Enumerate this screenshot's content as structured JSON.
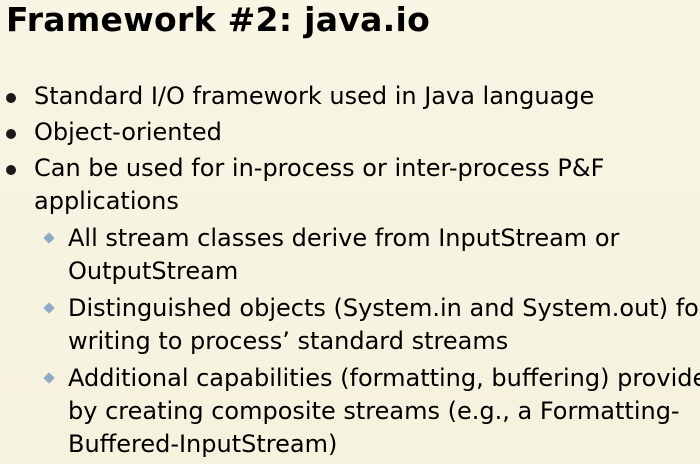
{
  "title": "Framework #2: java.io",
  "bullets": [
    {
      "lines": [
        "Standard I/O framework used in Java language"
      ]
    },
    {
      "lines": [
        "Object-oriented"
      ]
    },
    {
      "lines": [
        "Can be used for in-process or inter-process P&F",
        "applications"
      ],
      "sub_bullets": [
        {
          "lines": [
            "All stream classes derive from InputStream or",
            "OutputStream"
          ]
        },
        {
          "lines": [
            "Distinguished objects (System.in and System.out) for",
            "writing to process’ standard streams"
          ]
        },
        {
          "lines": [
            "Additional capabilities (formatting, buffering) provided",
            "by creating composite streams (e.g., a Formatting-",
            "Buffered-InputStream)"
          ]
        }
      ]
    }
  ],
  "colors": {
    "background": "#f6f3e1",
    "text": "#000000",
    "sub_bullet": "#8fa9c9"
  }
}
